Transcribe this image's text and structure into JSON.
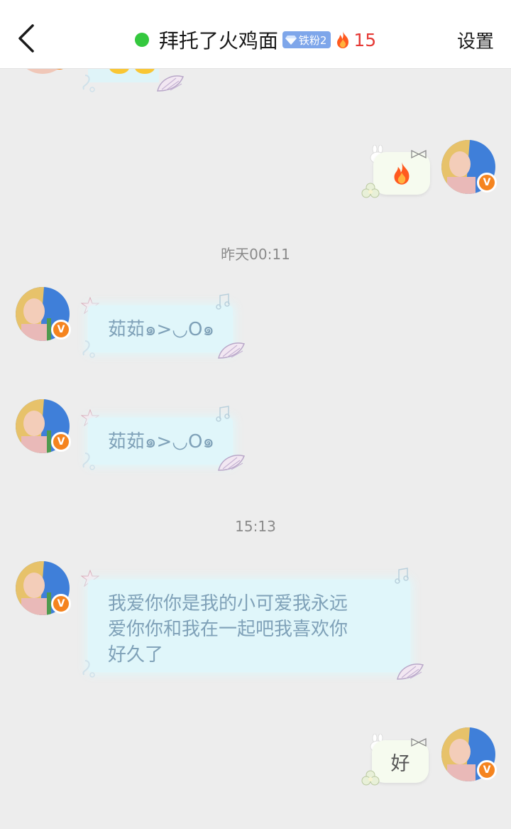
{
  "header": {
    "back_icon": "chevron-left-icon",
    "title": "拜托了火鸡面",
    "fan_badge": "铁粉2",
    "streak": "15",
    "settings_label": "设置",
    "online_color": "#34c83e"
  },
  "messages": [
    {
      "side": "right",
      "content": "🔥",
      "kind": "emoji"
    },
    {
      "side": "time",
      "content": "昨天00:11"
    },
    {
      "side": "left",
      "content": "茹茹๑>◡O๑"
    },
    {
      "side": "left",
      "content": "茹茹๑>◡O๑"
    },
    {
      "side": "time",
      "content": "15:13"
    },
    {
      "side": "left",
      "lines": [
        "我爱你你是我的小可爱我永远",
        "爱你你和我在一起吧我喜欢你",
        "好久了"
      ]
    },
    {
      "side": "right",
      "content": "好"
    }
  ],
  "colors": {
    "bubble_left": "#e0f6fa",
    "bubble_right": "#f6fbef",
    "badge_orange": "#f5841f",
    "streak_red": "#e53935"
  }
}
